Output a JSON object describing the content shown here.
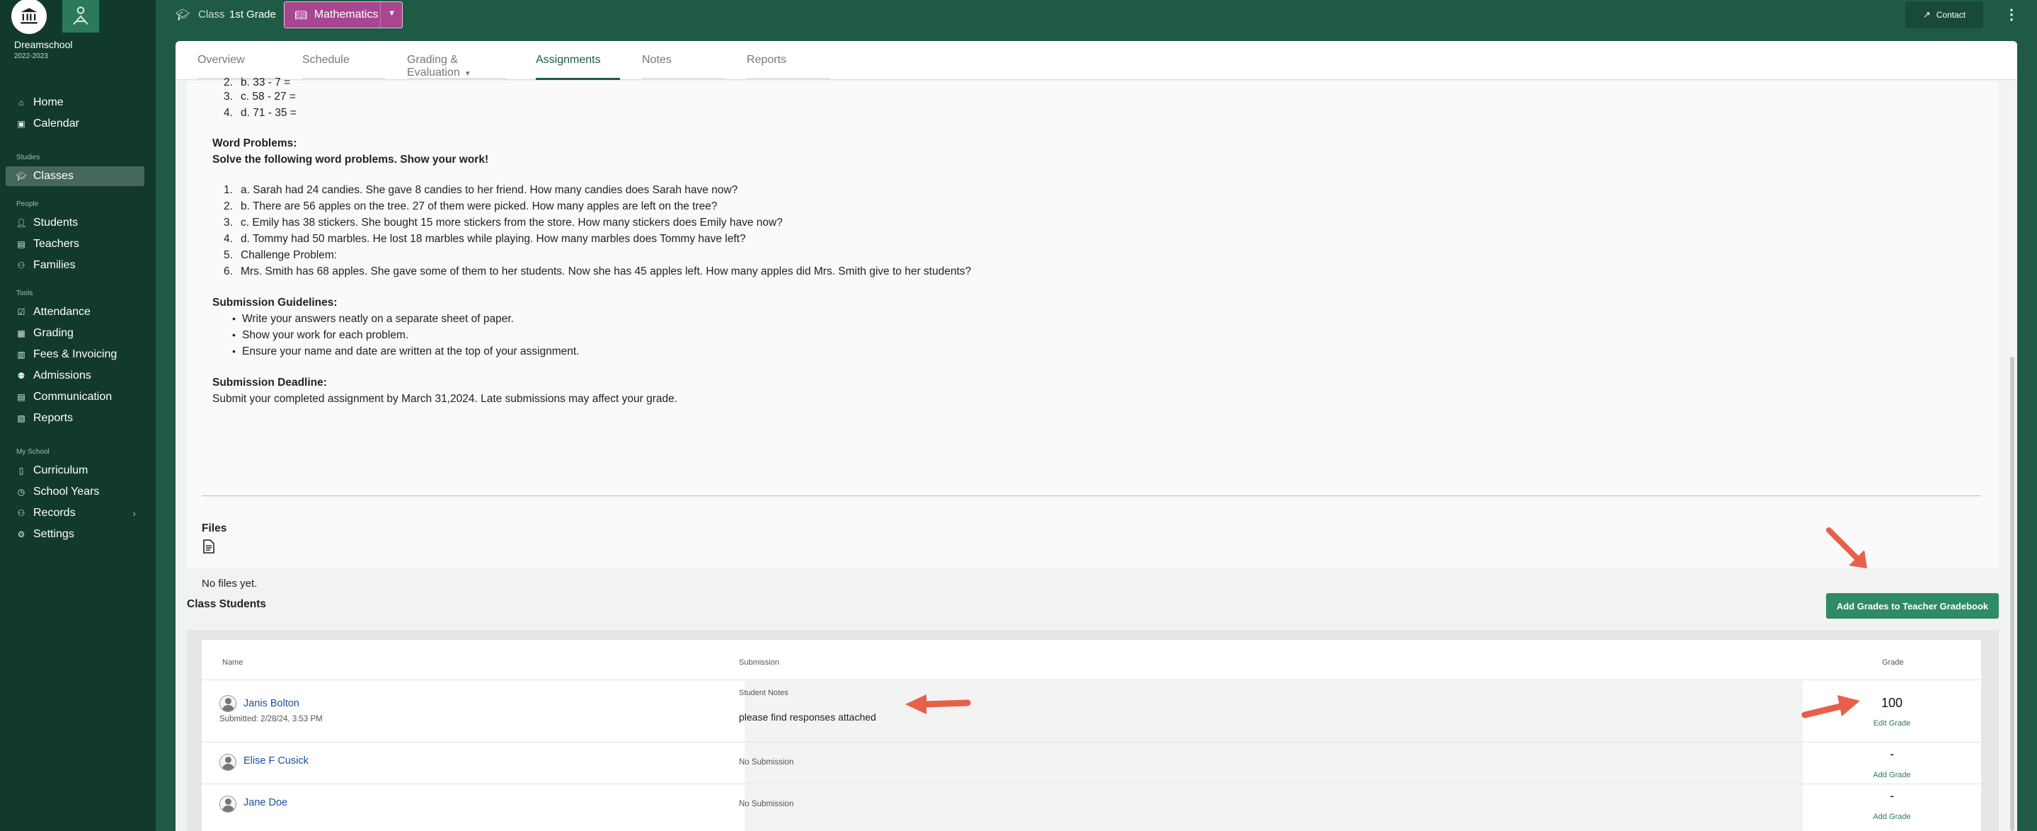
{
  "sidebar": {
    "school_name": "Dreamschool",
    "school_year": "2022-2023",
    "items": [
      {
        "label": "Home",
        "icon": "home-icon"
      },
      {
        "label": "Calendar",
        "icon": "calendar-icon"
      }
    ],
    "sections": [
      {
        "title": "Studies",
        "items": [
          {
            "label": "Classes",
            "icon": "graduation-cap-icon",
            "active": true
          }
        ]
      },
      {
        "title": "People",
        "items": [
          {
            "label": "Students",
            "icon": "user-icon"
          },
          {
            "label": "Teachers",
            "icon": "teacher-icon"
          },
          {
            "label": "Families",
            "icon": "users-icon"
          }
        ]
      },
      {
        "title": "Tools",
        "items": [
          {
            "label": "Attendance",
            "icon": "checklist-icon"
          },
          {
            "label": "Grading",
            "icon": "grading-icon"
          },
          {
            "label": "Fees & Invoicing",
            "icon": "invoice-icon"
          },
          {
            "label": "Admissions",
            "icon": "admissions-icon"
          },
          {
            "label": "Communication",
            "icon": "communication-icon"
          },
          {
            "label": "Reports",
            "icon": "report-icon"
          }
        ]
      },
      {
        "title": "My School",
        "items": [
          {
            "label": "Curriculum",
            "icon": "book-icon"
          },
          {
            "label": "School Years",
            "icon": "clock-icon"
          },
          {
            "label": "Records",
            "icon": "records-icon"
          },
          {
            "label": "Settings",
            "icon": "gear-icon"
          }
        ]
      }
    ]
  },
  "topbar": {
    "class_label": "Class",
    "grade": "1st Grade",
    "subject": "Mathematics",
    "contact_label": "Contact",
    "subject_color": "#a8468f"
  },
  "tabs": [
    {
      "label": "Overview"
    },
    {
      "label": "Schedule"
    },
    {
      "label": "Grading & Evaluation"
    },
    {
      "label": "Assignments",
      "active": true
    },
    {
      "label": "Notes"
    },
    {
      "label": "Reports"
    }
  ],
  "assignment": {
    "top_items": [
      "b. 33 - 7 =",
      "c. 58 - 27 =",
      "d. 71 - 35 ="
    ],
    "top_numbers": [
      "2.",
      "3.",
      "4."
    ],
    "word_problems_title": "Word Problems:",
    "word_problems_sub": "Solve the following word problems. Show your work!",
    "word_problems": [
      "a. Sarah had 24 candies. She gave 8 candies to her friend. How many candies does Sarah have now?",
      "b. There are 56 apples on the tree. 27 of them were picked. How many apples are left on the tree?",
      "c. Emily has 38 stickers. She bought 15 more stickers from the store. How many stickers does Emily have now?",
      "d. Tommy had 50 marbles. He lost 18 marbles while playing. How many marbles does Tommy have left?",
      "Challenge Problem:",
      "Mrs. Smith has 68 apples. She gave some of them to her students. Now she has 45 apples left. How many apples did Mrs. Smith give to her students?"
    ],
    "word_problem_numbers": [
      "1.",
      "2.",
      "3.",
      "4.",
      "5.",
      "6."
    ],
    "guidelines_title": "Submission Guidelines:",
    "guidelines": [
      "Write your answers neatly on a separate sheet of paper.",
      "Show your work for each problem.",
      "Ensure your name and date are written at the top of your assignment."
    ],
    "deadline_title": "Submission Deadline:",
    "deadline_text": "Submit your completed assignment by March 31,2024. Late submissions may affect your grade."
  },
  "files": {
    "title": "Files",
    "empty_text": "No files yet."
  },
  "class_students": {
    "title": "Class Students",
    "add_grades_label": "Add Grades to Teacher Gradebook",
    "headers": {
      "name": "Name",
      "submission": "Submission",
      "grade": "Grade"
    },
    "rows": [
      {
        "name": "Janis Bolton",
        "submitted": "Submitted: 2/28/24, 3:53 PM",
        "submission_label": "Student Notes",
        "submission_text": "please find responses attached",
        "grade": "100",
        "grade_action": "Edit Grade"
      },
      {
        "name": "Elise F Cusick",
        "submission_text": "No Submission",
        "grade": "-",
        "grade_action": "Add Grade"
      },
      {
        "name": "Jane Doe",
        "submission_text": "No Submission",
        "grade": "-",
        "grade_action": "Add Grade"
      }
    ]
  },
  "colors": {
    "brand_green": "#1f5b44",
    "sidebar_bg": "#123a2c",
    "button_green": "#2f8a66",
    "annotation_arrow": "#e8604a",
    "link_blue": "#1b4f9c"
  }
}
